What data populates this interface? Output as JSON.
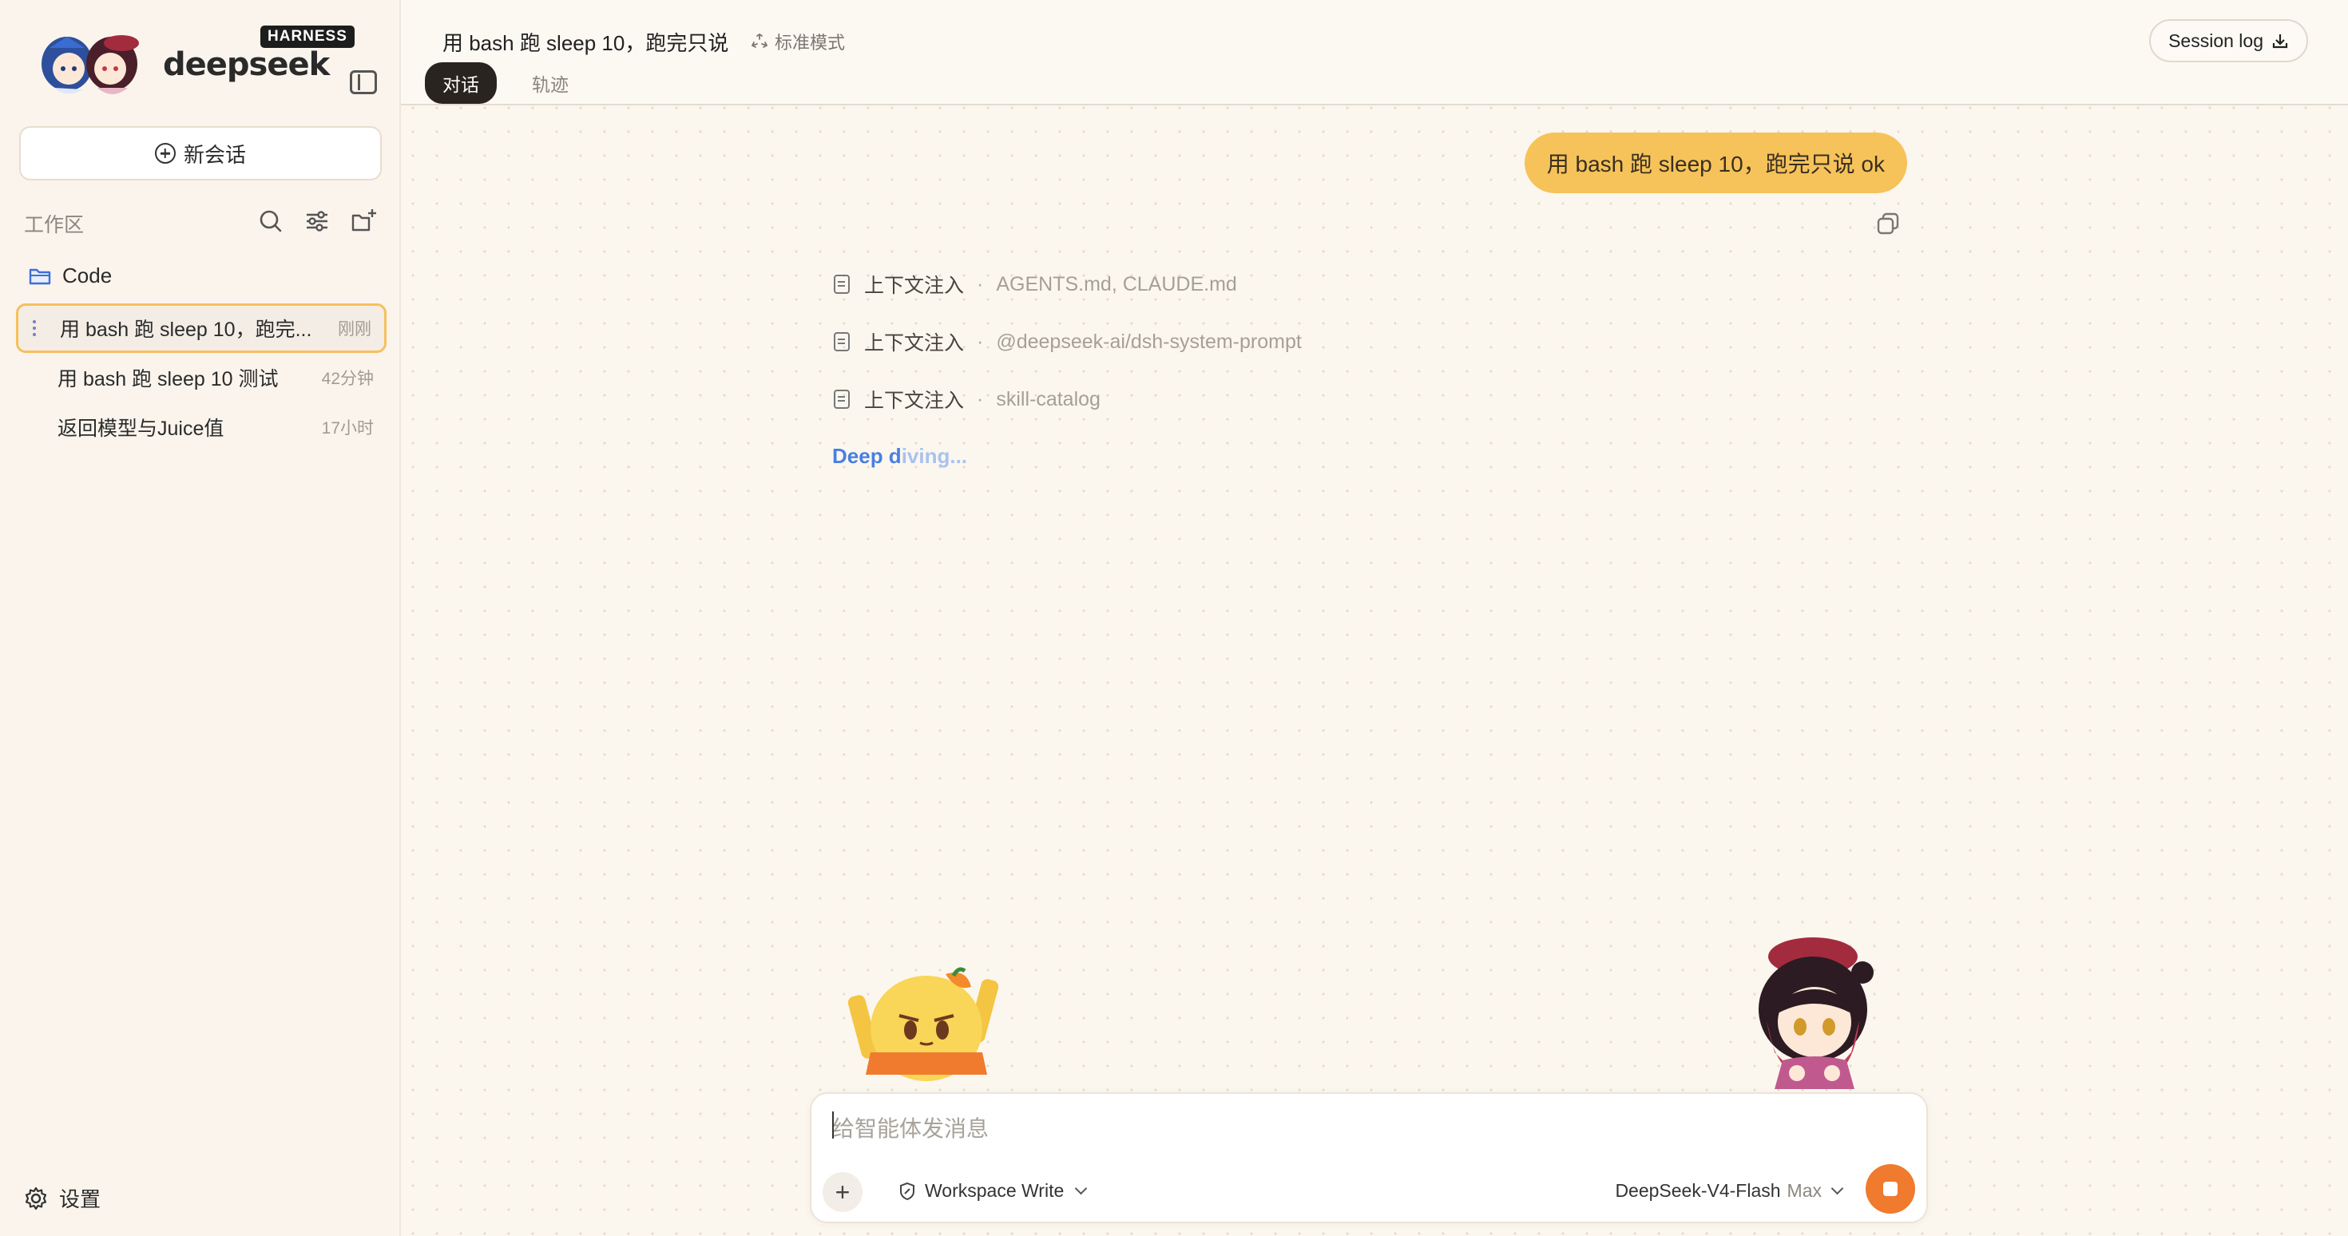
{
  "brand": {
    "name": "deepseek",
    "badge": "HARNESS"
  },
  "sidebar": {
    "new_chat_label": "新会话",
    "workspace_label": "工作区",
    "folder_name": "Code",
    "sessions": [
      {
        "title": "用 bash 跑 sleep 10，跑完...",
        "time": "刚刚"
      },
      {
        "title": "用 bash 跑 sleep 10 测试",
        "time": "42分钟"
      },
      {
        "title": "返回模型与Juice值",
        "time": "17小时"
      }
    ],
    "settings_label": "设置"
  },
  "header": {
    "title": "用 bash 跑 sleep 10，跑完只说",
    "mode": "标准模式",
    "tabs": [
      {
        "label": "对话",
        "active": true
      },
      {
        "label": "轨迹",
        "active": false
      }
    ],
    "session_log": "Session log"
  },
  "conversation": {
    "user_message": "用 bash 跑 sleep 10，跑完只说 ok",
    "context_items": [
      {
        "label": "上下文注入",
        "value": "AGENTS.md, CLAUDE.md"
      },
      {
        "label": "上下文注入",
        "value": "@deepseek-ai/dsh-system-prompt"
      },
      {
        "label": "上下文注入",
        "value": "skill-catalog"
      }
    ],
    "status_prefix": "Deep d",
    "status_suffix": "iving..."
  },
  "composer": {
    "placeholder": "给智能体发消息",
    "attach": "+",
    "permission": "Workspace Write",
    "model": "DeepSeek-V4-Flash",
    "effort": "Max"
  },
  "colors": {
    "accent": "#f6c35a",
    "stop": "#f07a2e",
    "link": "#4a7fe0",
    "background": "#fbf7ef"
  }
}
